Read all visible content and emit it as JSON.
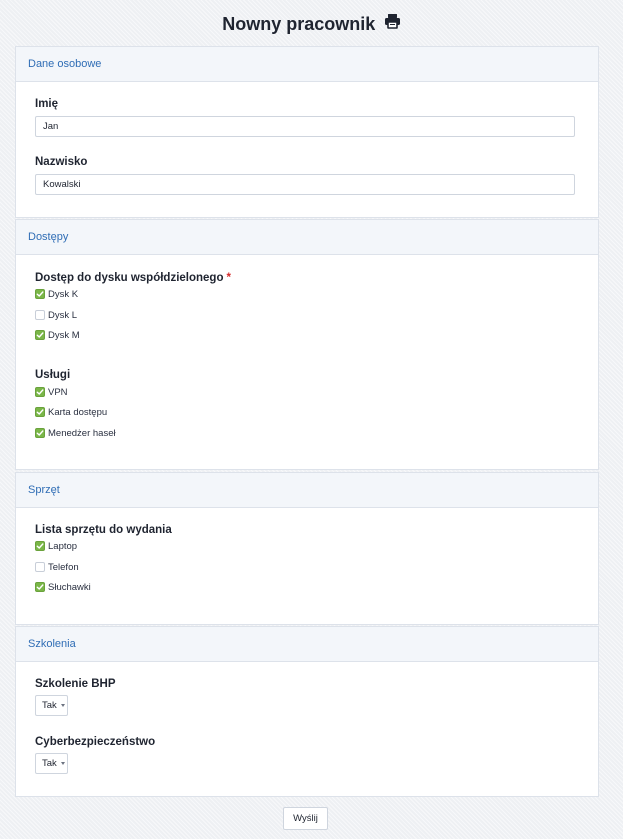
{
  "title": "Nowny pracownik",
  "sections": {
    "personal": {
      "header": "Dane osobowe",
      "first_name": {
        "label": "Imię",
        "value": "Jan"
      },
      "last_name": {
        "label": "Nazwisko",
        "value": "Kowalski"
      }
    },
    "access": {
      "header": "Dostępy",
      "disk": {
        "label": "Dostęp do dysku współdzielonego",
        "required_mark": "*",
        "options": [
          {
            "label": "Dysk K",
            "checked": true
          },
          {
            "label": "Dysk L",
            "checked": false
          },
          {
            "label": "Dysk M",
            "checked": true
          }
        ]
      },
      "services": {
        "label": "Usługi",
        "options": [
          {
            "label": "VPN",
            "checked": true
          },
          {
            "label": "Karta dostępu",
            "checked": true
          },
          {
            "label": "Menedżer haseł",
            "checked": true
          }
        ]
      }
    },
    "hardware": {
      "header": "Sprzęt",
      "list": {
        "label": "Lista sprzętu do wydania",
        "options": [
          {
            "label": "Laptop",
            "checked": true
          },
          {
            "label": "Telefon",
            "checked": false
          },
          {
            "label": "Słuchawki",
            "checked": true
          }
        ]
      }
    },
    "training": {
      "header": "Szkolenia",
      "bhp": {
        "label": "Szkolenie BHP",
        "value": "Tak"
      },
      "cyber": {
        "label": "Cyberbezpieczeństwo",
        "value": "Tak"
      }
    }
  },
  "submit_label": "Wyślij",
  "colors": {
    "accent": "#2f6db5",
    "checkbox_on": "#7ab648",
    "required": "#d62b2b"
  },
  "icons": {
    "print": "printer-icon"
  }
}
